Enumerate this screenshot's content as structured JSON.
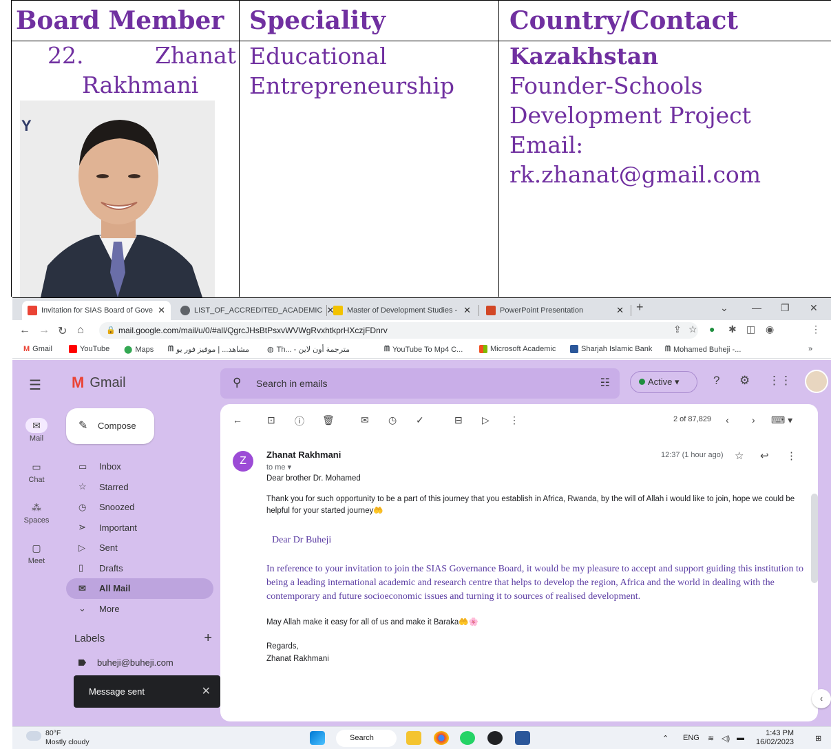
{
  "document": {
    "headers": [
      "Board Member",
      "Speciality",
      "Country/Contact"
    ],
    "member_number": "22.",
    "member_first_name": "Zhanat",
    "member_last_name": "Rakhmani",
    "speciality_lines": [
      "Educational",
      "Entrepreneurship"
    ],
    "country": "Kazakhstan",
    "contact_lines": [
      "Founder-Schools",
      "Development Project",
      "Email:",
      "rk.zhanat@gmail.com"
    ],
    "photo_logo_text": "Y"
  },
  "browser": {
    "tabs": [
      {
        "label": "Invitation for SIAS Board of Gove",
        "icon_color": "#ea4335",
        "active": true
      },
      {
        "label": "LIST_OF_ACCREDITED_ACADEMIC",
        "icon_color": "#5f6368",
        "active": false
      },
      {
        "label": "Master of Development Studies -",
        "icon_color": "#f2c200",
        "active": false
      },
      {
        "label": "PowerPoint Presentation",
        "icon_color": "#d24726",
        "active": false
      }
    ],
    "new_tab": "+",
    "url": "mail.google.com/mail/u/0/#all/QgrcJHsBtPsxvWVWgRvxhtkprHXczjFDnrv",
    "bookmarks": [
      "Gmail",
      "YouTube",
      "Maps",
      "مشاهد... | موفيز فور يو",
      "Th... - مترجمة أون لاين",
      "YouTube To Mp4 C...",
      "Microsoft Academic",
      "Sharjah Islamic Bank",
      "Mohamed Buheji -..."
    ],
    "bookmarks_more": "»"
  },
  "gmail": {
    "brand": "Gmail",
    "search_placeholder": "Search in emails",
    "status": "Active",
    "rail": [
      {
        "label": "Mail",
        "icon": "mail-icon"
      },
      {
        "label": "Chat",
        "icon": "chat-icon"
      },
      {
        "label": "Spaces",
        "icon": "spaces-icon"
      },
      {
        "label": "Meet",
        "icon": "meet-icon"
      }
    ],
    "compose": "Compose",
    "nav": [
      {
        "label": "Inbox",
        "icon": "inbox-icon",
        "glyph": "▭"
      },
      {
        "label": "Starred",
        "icon": "star-icon",
        "glyph": "☆"
      },
      {
        "label": "Snoozed",
        "icon": "clock-icon",
        "glyph": "◷"
      },
      {
        "label": "Important",
        "icon": "important-icon",
        "glyph": "⋗"
      },
      {
        "label": "Sent",
        "icon": "send-icon",
        "glyph": "▷"
      },
      {
        "label": "Drafts",
        "icon": "draft-icon",
        "glyph": "▯"
      },
      {
        "label": "All Mail",
        "icon": "all-mail-icon",
        "glyph": "✉"
      },
      {
        "label": "More",
        "icon": "chevron-down-icon",
        "glyph": "⌄"
      }
    ],
    "labels_heading": "Labels",
    "label_item": "buheji@buheji.com",
    "toast": "Message sent",
    "pagination": "2 of 87,829",
    "message": {
      "avatar_letter": "Z",
      "sender": "Zhanat Rakhmani",
      "to": "to me",
      "time": "12:37 (1 hour ago)",
      "greeting": "Dear brother Dr. Mohamed",
      "para1": "Thank you for such opportunity to be a part of this journey that you establish in Africa, Rwanda, by the will of Allah i would like to join, hope we could be helpful for your started journey🤲",
      "quote_greeting": "Dear Dr Buheji",
      "quote_body": "In reference to your invitation to join the SIAS Governance Board, it would be my pleasure to accept and support guiding this institution to being a leading international academic and research centre that helps to develop the region, Africa and the world in dealing with the contemporary and future socioeconomic issues and turning it to sources of realised development.",
      "para2": "May Allah make it easy for all of us and make it Baraka🤲🌸",
      "signoff": "Regards,",
      "signature": "Zhanat Rakhmani"
    }
  },
  "taskbar": {
    "temperature": "80°F",
    "weather": "Mostly cloudy",
    "search": "Search",
    "lang": "ENG",
    "time": "1:43 PM",
    "date": "16/02/2023"
  }
}
